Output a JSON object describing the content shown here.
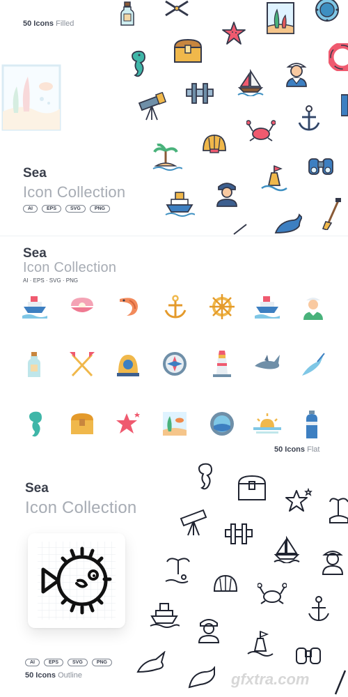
{
  "filled": {
    "count_label": "50 Icons",
    "style_label": "Filled",
    "title": "Sea",
    "subtitle": "Icon Collection",
    "formats": [
      "AI",
      "EPS",
      "SVG",
      "PNG"
    ]
  },
  "flat": {
    "title": "Sea",
    "subtitle": "Icon Collection",
    "formats_line": "AI · EPS · SVG · PNG",
    "count_label": "50 Icons",
    "style_label": "Flat"
  },
  "outline": {
    "title": "Sea",
    "subtitle": "Icon Collection",
    "formats": [
      "AI",
      "EPS",
      "SVG",
      "PNG"
    ],
    "count_label": "50 Icons",
    "style_label": "Outline"
  },
  "watermark": "gfxtra.com",
  "icons": [
    "bottle-icon",
    "seaweed-icon",
    "porthole-icon",
    "starfish-icon",
    "seahorse-icon",
    "treasure-chest-icon",
    "lifebuoy-icon",
    "telescope-icon",
    "pipe-icon",
    "sailboat-icon",
    "sailor-icon",
    "shell-icon",
    "crab-icon",
    "anchor-icon",
    "island-icon",
    "buoy-icon",
    "binoculars-icon",
    "ship-icon",
    "captain-icon",
    "whale-icon",
    "paddle-icon",
    "clam-pearl-icon",
    "shrimp-icon",
    "helm-icon",
    "diving-helmet-icon",
    "compass-icon",
    "lighthouse-icon",
    "shark-icon",
    "swordfish-icon",
    "sunset-icon",
    "oxygen-tank-icon",
    "aquarium-icon",
    "pufferfish-icon",
    "dolphin-icon"
  ]
}
